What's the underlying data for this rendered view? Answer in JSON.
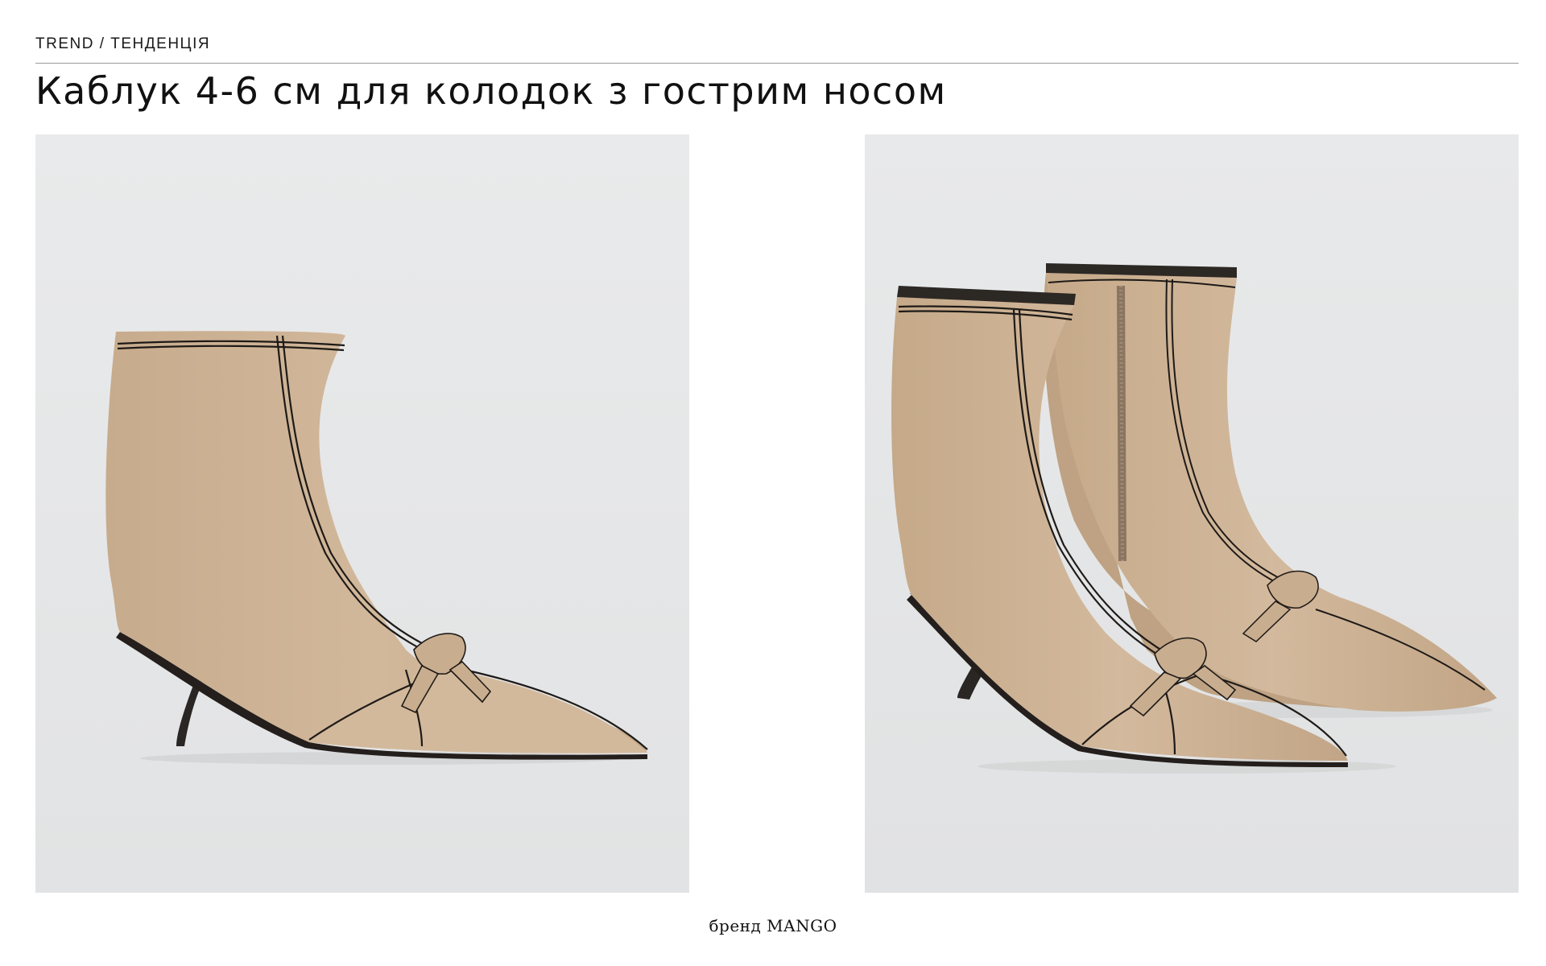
{
  "header": {
    "eyebrow": "TREND / ТЕНДЕНЦІЯ",
    "title": "Каблук 4-6 см для колодок з гострим носом"
  },
  "photos": [
    {
      "name": "single-ankle-boot-side-view"
    },
    {
      "name": "pair-ankle-boots-three-quarter-view"
    }
  ],
  "footer": {
    "caption": "бренд MANGO"
  },
  "colors": {
    "background": "#e6e7e8",
    "leather": "#cfb497",
    "leather_shadow": "#b89b7d",
    "stitching": "#1e1a17",
    "heel": "#2a2624"
  }
}
